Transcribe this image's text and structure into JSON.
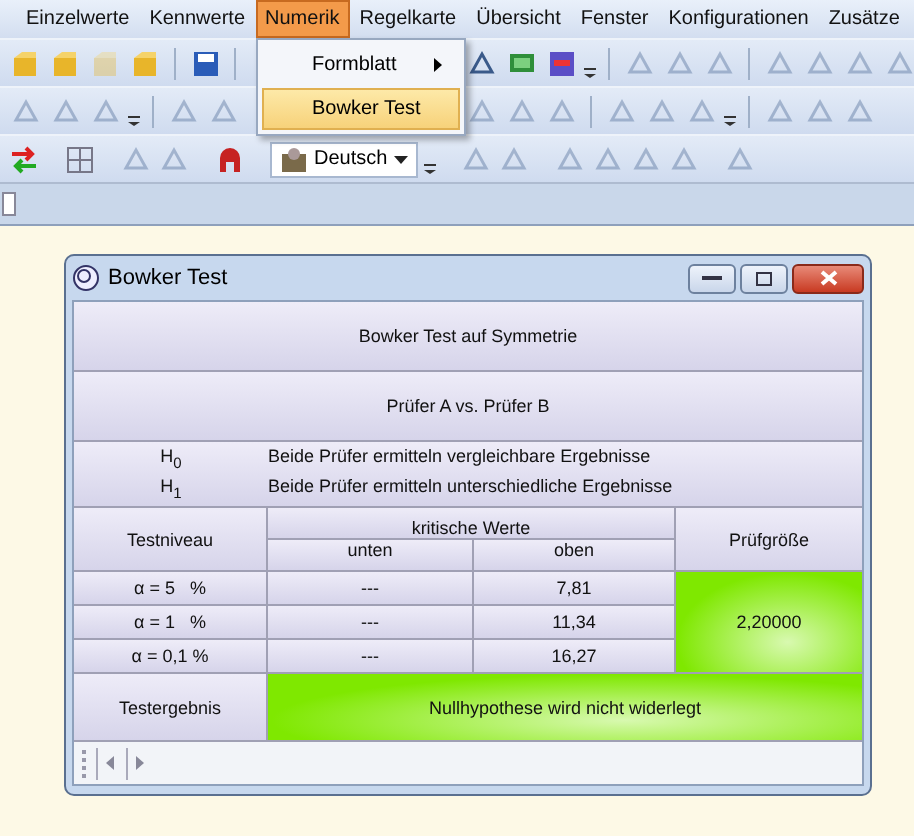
{
  "menu_bar": {
    "items": [
      {
        "label": "Einzelwerte",
        "selected": false
      },
      {
        "label": "Kennwerte",
        "selected": false
      },
      {
        "label": "Numerik",
        "selected": true
      },
      {
        "label": "Regelkarte",
        "selected": false
      },
      {
        "label": "Übersicht",
        "selected": false
      },
      {
        "label": "Fenster",
        "selected": false
      },
      {
        "label": "Konfigurationen",
        "selected": false
      },
      {
        "label": "Zusätze",
        "selected": false
      }
    ]
  },
  "dropdown_menu": {
    "items": [
      {
        "label": "Formblatt",
        "submenu": true,
        "selected": false
      },
      {
        "label": "Bowker Test",
        "submenu": false,
        "selected": true
      }
    ]
  },
  "toolbars": [
    [
      [
        {
          "kind": "folder",
          "disabled": false
        },
        {
          "kind": "folder",
          "disabled": false
        },
        {
          "kind": "folder",
          "disabled": true
        },
        {
          "kind": "folder",
          "disabled": false
        },
        {
          "kind": "separator"
        },
        {
          "kind": "save",
          "disabled": false
        },
        {
          "kind": "separator"
        }
      ],
      [
        {
          "kind": "tool",
          "disabled": false
        },
        {
          "kind": "monitor",
          "disabled": false
        },
        {
          "kind": "chart",
          "disabled": false
        },
        {
          "kind": "overflow"
        },
        {
          "kind": "separator"
        },
        {
          "kind": "tool",
          "disabled": true
        },
        {
          "kind": "tool",
          "disabled": true
        },
        {
          "kind": "tool",
          "disabled": true
        },
        {
          "kind": "separator"
        },
        {
          "kind": "tool",
          "disabled": true
        },
        {
          "kind": "tool",
          "disabled": true
        },
        {
          "kind": "tool",
          "disabled": true
        },
        {
          "kind": "tool",
          "disabled": true
        }
      ]
    ],
    [
      [
        {
          "kind": "tool",
          "disabled": true
        },
        {
          "kind": "tool",
          "disabled": true
        },
        {
          "kind": "tool",
          "disabled": true
        },
        {
          "kind": "overflow"
        },
        {
          "kind": "separator"
        },
        {
          "kind": "tool",
          "disabled": true
        },
        {
          "kind": "tool",
          "disabled": true
        }
      ],
      [
        {
          "kind": "tool",
          "disabled": true
        },
        {
          "kind": "tool",
          "disabled": true
        },
        {
          "kind": "tool",
          "disabled": true
        },
        {
          "kind": "separator"
        },
        {
          "kind": "tool",
          "disabled": true
        },
        {
          "kind": "tool",
          "disabled": true
        },
        {
          "kind": "tool",
          "disabled": true
        },
        {
          "kind": "overflow"
        },
        {
          "kind": "separator"
        },
        {
          "kind": "tool",
          "disabled": true
        },
        {
          "kind": "tool",
          "disabled": true
        },
        {
          "kind": "tool",
          "disabled": true
        }
      ]
    ],
    [
      [
        {
          "kind": "arrows",
          "disabled": false
        },
        {
          "kind": "separator"
        },
        {
          "kind": "grid",
          "disabled": false
        },
        {
          "kind": "separator"
        },
        {
          "kind": "tool",
          "disabled": true
        },
        {
          "kind": "tool",
          "disabled": true
        },
        {
          "kind": "separator"
        },
        {
          "kind": "home",
          "disabled": false
        },
        {
          "kind": "separator"
        },
        {
          "kind": "language",
          "value": "Deutsch"
        },
        {
          "kind": "overflow"
        },
        {
          "kind": "separator"
        },
        {
          "kind": "tool",
          "disabled": true
        },
        {
          "kind": "tool",
          "disabled": true
        },
        {
          "kind": "separator"
        },
        {
          "kind": "tool",
          "disabled": true
        },
        {
          "kind": "tool",
          "disabled": true
        },
        {
          "kind": "tool",
          "disabled": true
        },
        {
          "kind": "tool",
          "disabled": true
        },
        {
          "kind": "separator"
        },
        {
          "kind": "tool",
          "disabled": true
        }
      ]
    ]
  ],
  "window": {
    "title": "Bowker Test",
    "heading": "Bowker Test auf Symmetrie",
    "comparison": "Prüfer A vs. Prüfer B",
    "hypotheses": [
      {
        "symbol": "H$_{0}$",
        "text": "Beide Prüfer ermitteln vergleichbare Ergebnisse"
      },
      {
        "symbol": "H$_{1}$",
        "text": "Beide Prüfer ermitteln unterschiedliche Ergebnisse"
      }
    ],
    "columns": {
      "level": "Testniveau",
      "critical": "kritische Werte",
      "lower": "unten",
      "upper": "oben",
      "statistic": "Prüfgröße"
    },
    "rows": [
      {
        "level": "α = 5   %",
        "lower": "---",
        "upper": "7,81"
      },
      {
        "level": "α = 1   %",
        "lower": "---",
        "upper": "11,34"
      },
      {
        "level": "α = 0,1 %",
        "lower": "---",
        "upper": "16,27"
      }
    ],
    "statistic": {
      "value": "2,20000",
      "significant": false
    },
    "result": {
      "label": "Testergebnis",
      "text": "Nullhypothese wird nicht widerlegt",
      "rejected": false
    }
  }
}
